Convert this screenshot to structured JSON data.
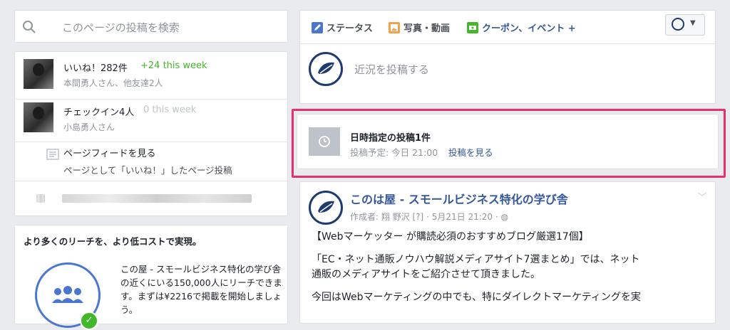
{
  "search": {
    "placeholder": "このページの投稿を検索"
  },
  "stats": {
    "likes": {
      "main": "いいね！282件",
      "delta": "+24 this week",
      "sub": "本間勇人さん、他友達2人"
    },
    "checkins": {
      "main": "チェックイン4人",
      "delta": "0 this week",
      "sub": "小島勇人さん"
    },
    "feed": {
      "main": "ページフィードを見る",
      "sub": "ページとして「いいね！」したページ投稿"
    }
  },
  "promo": {
    "heading": "より多くのリーチを、より低コストで実現。",
    "body": "この屋 - スモールビジネス特化の学び舎の近くにいる150,000人にリーチできます。まずは¥2216で掲載を開始しましょう。"
  },
  "composer": {
    "tabs": [
      {
        "label": "ステータス",
        "icon": "pencil-icon"
      },
      {
        "label": "写真・動画",
        "icon": "photo-icon"
      },
      {
        "label": "クーポン、イベント +",
        "icon": "coupon-icon"
      }
    ],
    "placeholder": "近況を投稿する"
  },
  "scheduled": {
    "title": "日時指定の投稿1件",
    "detail": "投稿予定: 今日 21:00",
    "link": "投稿を見る"
  },
  "post": {
    "page_name": "このは屋 - スモールビジネス特化の学び舎",
    "author": "作成者: 翔 野沢 [?]",
    "date": "5月21日 21:20",
    "lines": [
      "【Webマーケッター が購読必須のおすすめブログ厳選17個】",
      "「EC・ネット通販ノウハウ解説メディアサイト7選まとめ」では、ネット",
      "通販のメディアサイトをご紹介させて頂きました。",
      "今回はWebマーケティングの中でも、特にダイレクトマーケティングを実"
    ]
  },
  "colors": {
    "link": "#365899",
    "highlight": "#e8316b",
    "green": "#42b72a"
  }
}
